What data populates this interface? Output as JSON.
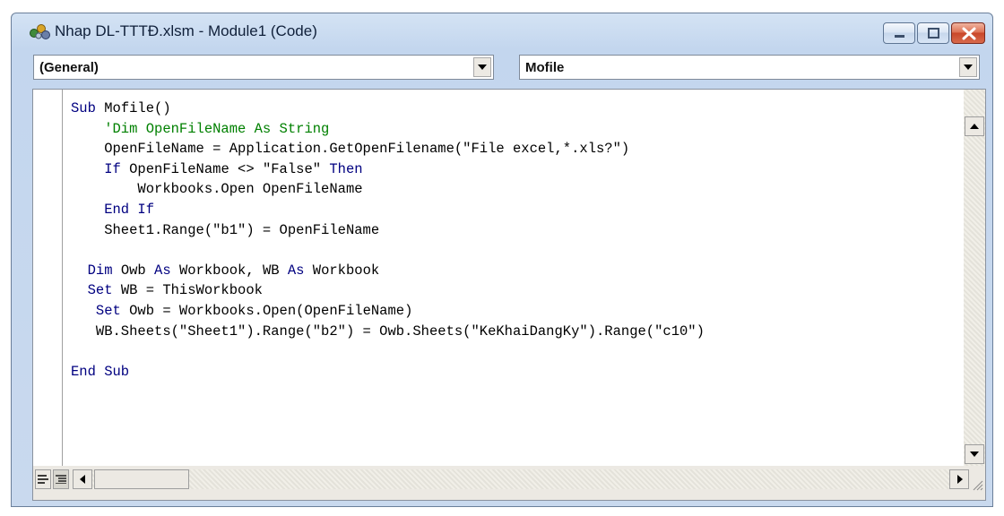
{
  "window": {
    "title": "Nhap DL-TTTĐ.xlsm - Module1 (Code)",
    "controls": {
      "minimize": "minimize",
      "maximize": "maximize",
      "close": "close"
    }
  },
  "selectors": {
    "object": "(General)",
    "procedure": "Mofile"
  },
  "code": {
    "lines": [
      [
        {
          "t": "kw",
          "v": "Sub "
        },
        {
          "t": "tx",
          "v": "Mofile()"
        }
      ],
      [
        {
          "t": "cm",
          "v": "    'Dim OpenFileName As String"
        }
      ],
      [
        {
          "t": "tx",
          "v": "    OpenFileName = Application.GetOpenFilename(\"File excel,*.xls?\")"
        }
      ],
      [
        {
          "t": "kw",
          "v": "    If "
        },
        {
          "t": "tx",
          "v": "OpenFileName <> \"False\" "
        },
        {
          "t": "kw",
          "v": "Then"
        }
      ],
      [
        {
          "t": "tx",
          "v": "        Workbooks.Open OpenFileName"
        }
      ],
      [
        {
          "t": "kw",
          "v": "    End If"
        }
      ],
      [
        {
          "t": "tx",
          "v": "    Sheet1.Range(\"b1\") = OpenFileName"
        }
      ],
      [
        {
          "t": "tx",
          "v": ""
        }
      ],
      [
        {
          "t": "kw",
          "v": "  Dim "
        },
        {
          "t": "tx",
          "v": "Owb "
        },
        {
          "t": "kw",
          "v": "As "
        },
        {
          "t": "tx",
          "v": "Workbook, WB "
        },
        {
          "t": "kw",
          "v": "As "
        },
        {
          "t": "tx",
          "v": "Workbook"
        }
      ],
      [
        {
          "t": "kw",
          "v": "  Set "
        },
        {
          "t": "tx",
          "v": "WB = ThisWorkbook"
        }
      ],
      [
        {
          "t": "kw",
          "v": "   Set "
        },
        {
          "t": "tx",
          "v": "Owb = Workbooks.Open(OpenFileName)"
        }
      ],
      [
        {
          "t": "tx",
          "v": "   WB.Sheets(\"Sheet1\").Range(\"b2\") = Owb.Sheets(\"KeKhaiDangKy\").Range(\"c10\")"
        }
      ],
      [
        {
          "t": "tx",
          "v": ""
        }
      ],
      [
        {
          "t": "kw",
          "v": "End Sub"
        }
      ]
    ]
  },
  "colors": {
    "keyword": "#000080",
    "comment": "#008000",
    "text": "#000000"
  },
  "icons": {
    "app": "vba-project-icon",
    "dropdown": "chevron-down-icon",
    "scroll_up": "arrow-up-icon",
    "scroll_down": "arrow-down-icon",
    "scroll_left": "arrow-left-icon",
    "scroll_right": "arrow-right-icon",
    "procedure_view": "procedure-view-icon",
    "full_module_view": "full-module-view-icon"
  }
}
